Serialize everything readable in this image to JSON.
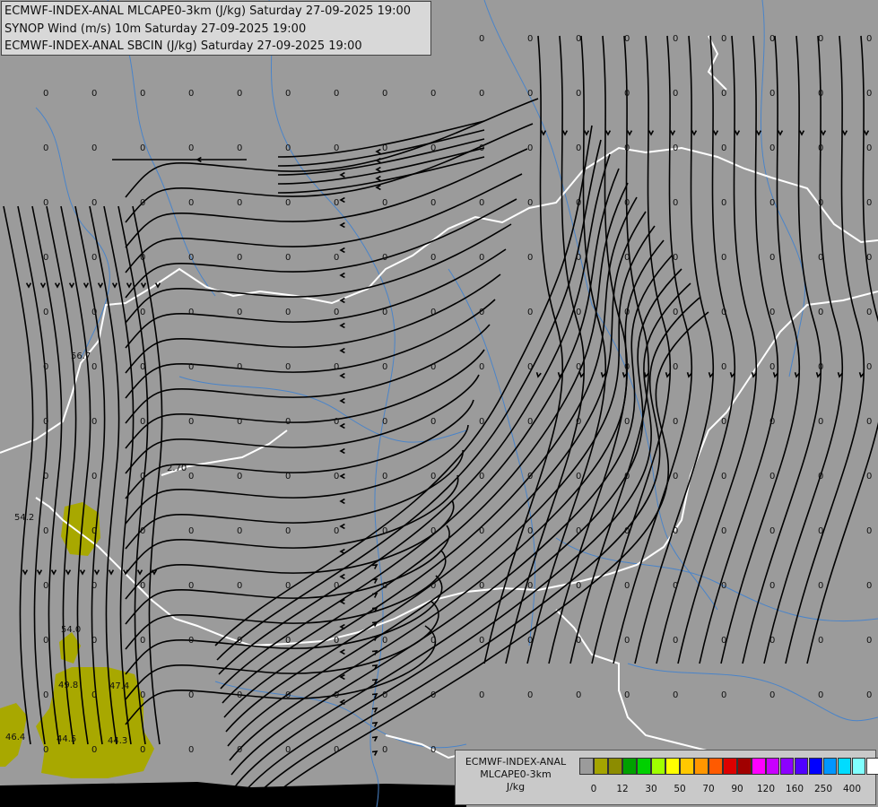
{
  "header": {
    "line1": "ECMWF-INDEX-ANAL MLCAPE0-3km (J/kg) Saturday 27-09-2025 19:00",
    "line2": "SYNOP Wind (m/s) 10m Saturday 27-09-2025 19:00",
    "line3": "ECMWF-INDEX-ANAL SBCIN (J/kg) Saturday 27-09-2025 19:00"
  },
  "legend": {
    "title_line1": "ECMWF-INDEX-ANAL",
    "title_line2": "MLCAPE0-3km",
    "unit": "J/kg",
    "colors": [
      "#9b9b9b",
      "#a4a400",
      "#8c8c00",
      "#00a000",
      "#00d000",
      "#a0ff00",
      "#ffff00",
      "#ffc800",
      "#ff9600",
      "#ff5a00",
      "#dc0000",
      "#a00000",
      "#ff00ff",
      "#c800ff",
      "#8c00ff",
      "#5000ff",
      "#0000ff",
      "#0096ff",
      "#00dcff",
      "#80ffff",
      "#ffffff"
    ],
    "ticks": [
      "0",
      "12",
      "30",
      "50",
      "70",
      "90",
      "120",
      "160",
      "250",
      "400"
    ]
  },
  "cin_labels": [
    "54.2",
    "56.7",
    "2.70",
    "54.0",
    "49.8",
    "47.4",
    "46.4",
    "44.5",
    "44.3"
  ],
  "map_colors": {
    "background": "#9b9b9b",
    "rivers": "#4a84c9",
    "borders": "#ffffff",
    "cape_fill": "#a8a800",
    "sea": "#000000"
  }
}
